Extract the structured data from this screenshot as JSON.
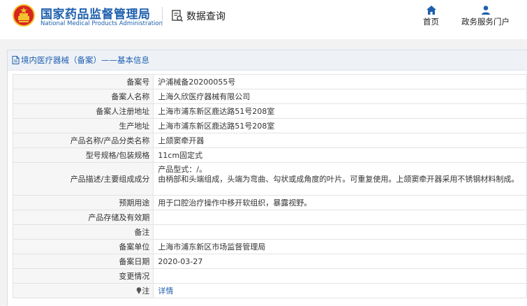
{
  "header": {
    "brand_cn": "国家药品监督管理局",
    "brand_en": "National Medical Products Administration",
    "data_query": "数据查询",
    "nav": [
      {
        "label": "首页",
        "icon": "home-icon"
      },
      {
        "label": "政务服务门户",
        "icon": "user-icon"
      }
    ]
  },
  "panel": {
    "title": "境内医疗器械（备案）——基本信息"
  },
  "rows": [
    {
      "label": "备案号",
      "value": "沪浦械备20200055号"
    },
    {
      "label": "备案人名称",
      "value": "上海久欣医疗器械有限公司"
    },
    {
      "label": "备案人注册地址",
      "value": "上海市浦东新区鹿达路51号208室"
    },
    {
      "label": "生产地址",
      "value": "上海市浦东新区鹿达路51号208室"
    },
    {
      "label": "产品名称/产品分类名称",
      "value": "上颌窦牵开器"
    },
    {
      "label": "型号规格/包装规格",
      "value": "11cm固定式"
    },
    {
      "label": "产品描述/主要组成成分",
      "value_line1": "产品型式：/。",
      "value_line2": "由柄部和头端组成，头端为弯曲、勾状或成角度的叶片。可重复使用。上颌窦牵开器采用不锈钢材料制成。"
    },
    {
      "label": "预期用途",
      "value": "用于口腔治疗操作中移开软组织，暴露视野。"
    },
    {
      "label": "产品存储及有效期",
      "value": ""
    },
    {
      "label": "备注",
      "value": ""
    },
    {
      "label": "备案单位",
      "value": "上海市浦东新区市场监督管理局"
    },
    {
      "label": "备案日期",
      "value": "2020-03-27"
    },
    {
      "label": "变更情况",
      "value": ""
    },
    {
      "label": "注",
      "value": "详情"
    }
  ],
  "colors": {
    "brand_blue": "#1f5fae",
    "emblem_red": "#d7261e",
    "emblem_gold": "#f2c230"
  }
}
